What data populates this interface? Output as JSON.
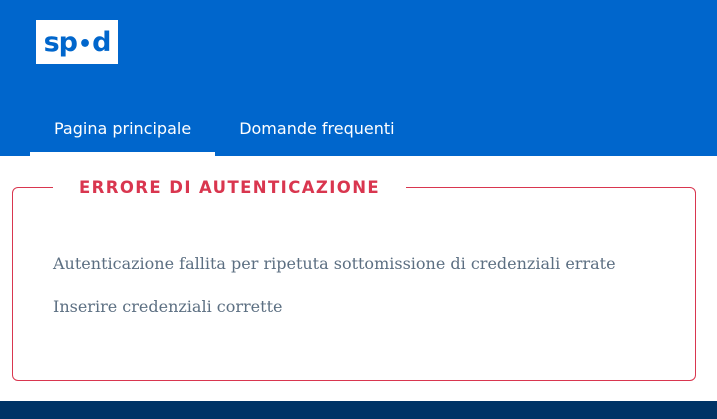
{
  "brand": {
    "logo_text": "spid"
  },
  "nav": {
    "items": [
      {
        "label": "Pagina principale",
        "active": true
      },
      {
        "label": "Domande frequenti",
        "active": false
      }
    ]
  },
  "error": {
    "title": "ERRORE DI AUTENTICAZIONE",
    "messages": [
      "Autenticazione fallita per ripetuta sottomissione di credenziali errate",
      "Inserire credenziali corrette"
    ]
  },
  "colors": {
    "header": "#0066cc",
    "error_accent": "#d9364f",
    "text": "#5c6f82",
    "footer": "#003366"
  }
}
